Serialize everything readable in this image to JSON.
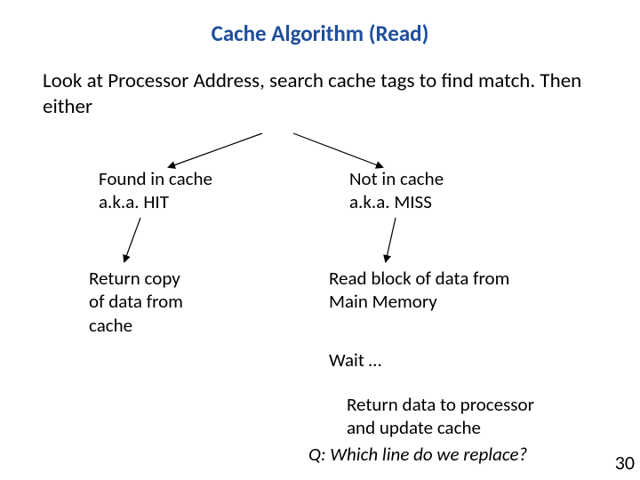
{
  "title": "Cache Algorithm (Read)",
  "intro": "Look at Processor Address, search cache tags to find match.  Then either",
  "left": {
    "label1": "Found in cache",
    "label2": "a.k.a.  HIT",
    "result1": "Return copy",
    "result2": "of data from",
    "result3": "cache"
  },
  "right": {
    "label1": "Not in cache",
    "label2": "a.k.a. MISS",
    "step1a": "Read block of data from",
    "step1b": "Main Memory",
    "step2": "Wait …",
    "step3a": "Return data to processor",
    "step3b": "and update cache"
  },
  "question": "Q: Which line do we replace?",
  "page": "30"
}
